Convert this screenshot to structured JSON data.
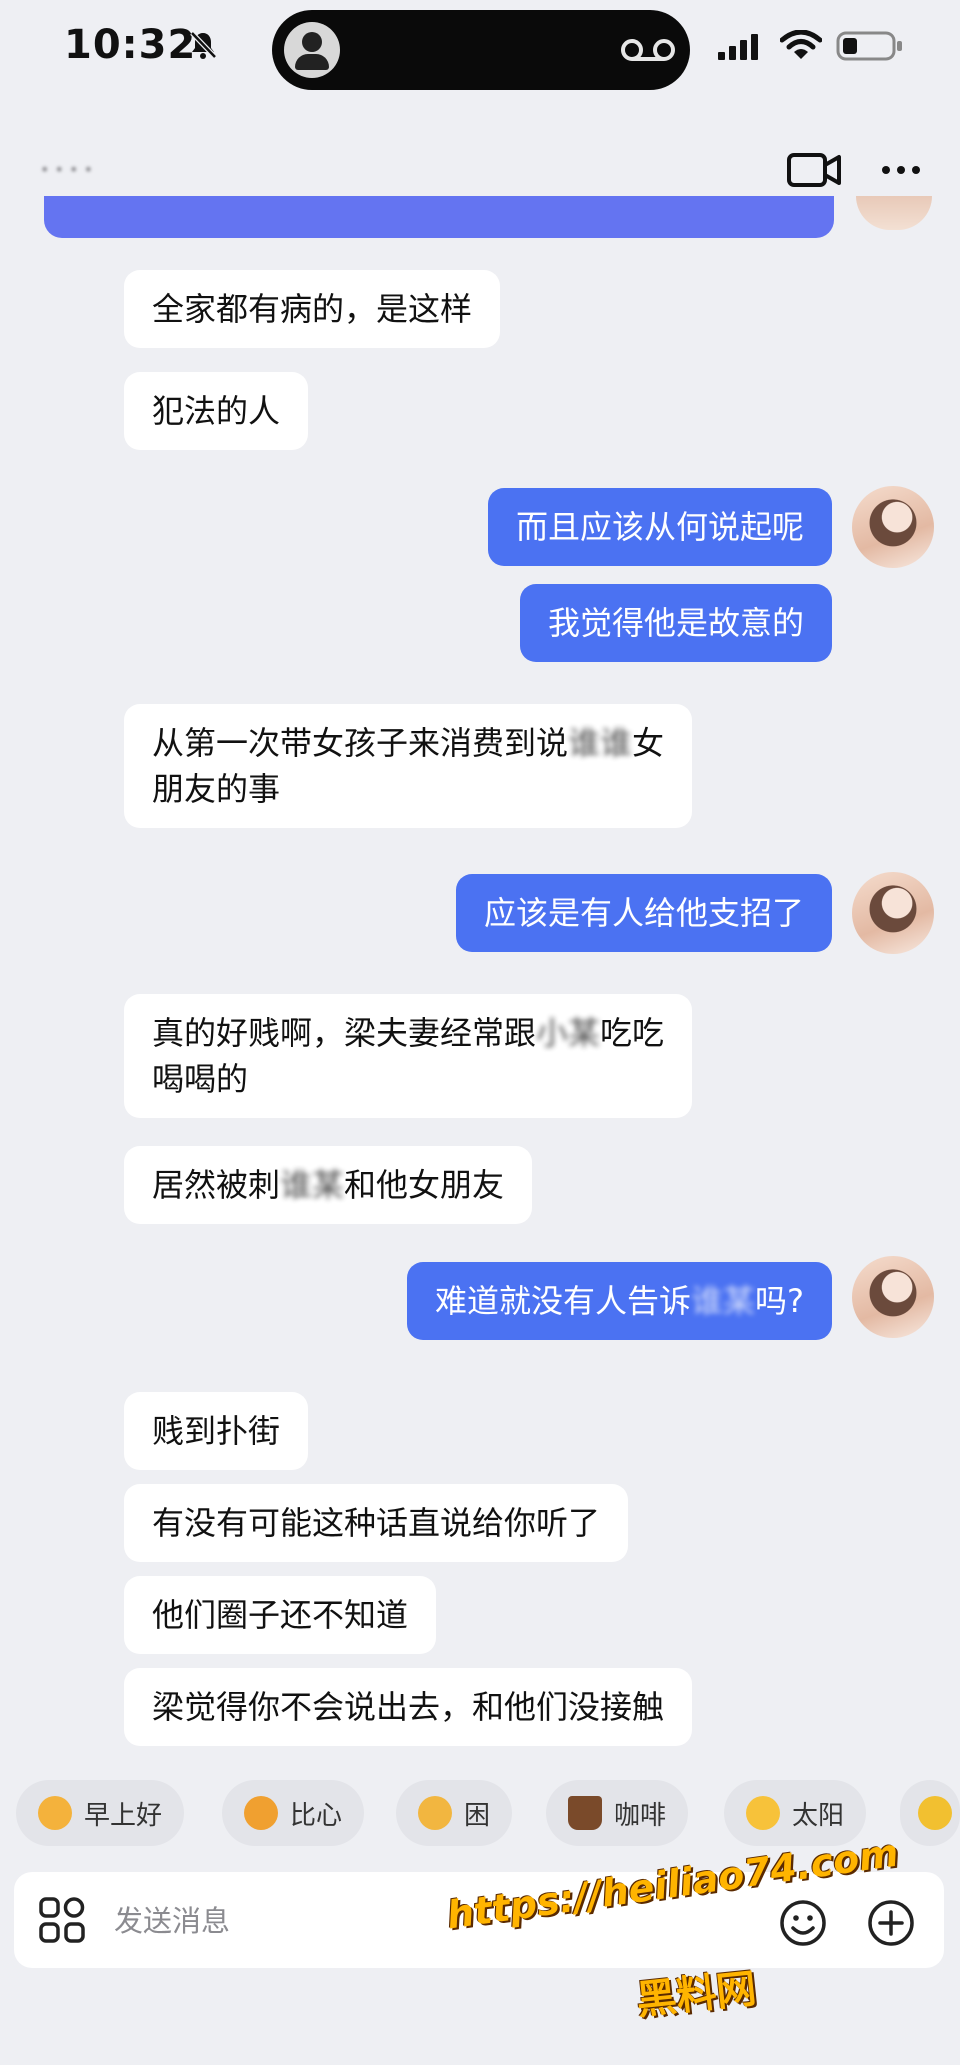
{
  "status_bar": {
    "time": "10:32"
  },
  "header": {
    "contact_name": "• • • •",
    "video_call_icon": "video-camera-icon",
    "more_icon": "more-dots-icon"
  },
  "messages": [
    {
      "side": "in",
      "text": "全家都有病的，是这样"
    },
    {
      "side": "in",
      "text": "犯法的人"
    },
    {
      "side": "out",
      "text": "而且应该从何说起呢"
    },
    {
      "side": "out",
      "text": "我觉得他是故意的"
    },
    {
      "side": "in",
      "text_before": "从第一次带女孩子来消费到说",
      "text_blurred": "谁谁",
      "text_after": "女\n朋友的事"
    },
    {
      "side": "out",
      "text": "应该是有人给他支招了"
    },
    {
      "side": "in",
      "text_before": "真的好贱啊，梁夫妻经常跟",
      "text_blurred": "小某",
      "text_after": "吃吃\n喝喝的"
    },
    {
      "side": "in",
      "text_before": "居然被刺",
      "text_blurred": "谁某",
      "text_after": "和他女朋友"
    },
    {
      "side": "out",
      "text_before": "难道就没有人告诉",
      "text_blurred": "谁某",
      "text_after": "吗?"
    },
    {
      "side": "in",
      "text": "贱到扑街"
    },
    {
      "side": "in",
      "text": "有没有可能这种话直说给你听了"
    },
    {
      "side": "in",
      "text": "他们圈子还不知道"
    },
    {
      "side": "in",
      "text": "梁觉得你不会说出去，和他们没接触"
    }
  ],
  "quick_replies": [
    {
      "label": "早上好",
      "color": "#f4b23c"
    },
    {
      "label": "比心",
      "color": "#f0a030"
    },
    {
      "label": "困",
      "color": "#f2b640"
    },
    {
      "label": "咖啡",
      "color": "#7a4a2a"
    },
    {
      "label": "太阳",
      "color": "#f7c23a"
    }
  ],
  "input": {
    "placeholder": "发送消息"
  },
  "watermark": {
    "url": "https://heiliao74.com",
    "name": "黑料网"
  },
  "colors": {
    "outgoing_bubble": "#4b72f2",
    "incoming_bubble": "#ffffff",
    "background": "#eeeff3"
  }
}
